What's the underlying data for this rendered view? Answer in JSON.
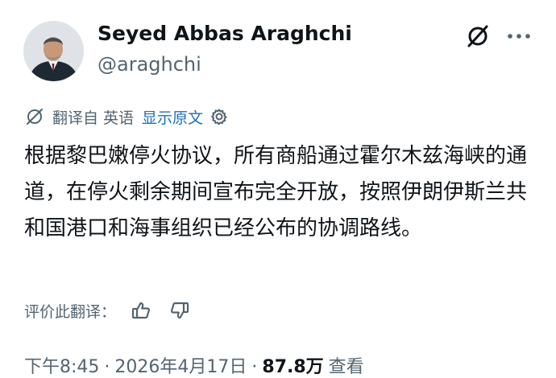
{
  "author": {
    "name": "Seyed Abbas Araghchi",
    "handle": "@araghchi"
  },
  "icons": {
    "grok": "slashed-circle-icon",
    "more": "more-dots-icon",
    "translate": "translate-icon",
    "settings": "gear-icon",
    "like": "thumbs-up-icon",
    "dislike": "thumbs-down-icon"
  },
  "translation": {
    "label": "翻译自 英语",
    "show_original": "显示原文"
  },
  "tweet": {
    "text": "根据黎巴嫩停火协议，所有商船通过霍尔木兹海峡的通道，在停火剩余期间宣布完全开放，按照伊朗伊斯兰共和国港口和海事组织已经公布的协调路线。"
  },
  "rating": {
    "label": "评价此翻译："
  },
  "meta": {
    "time": "下午8:45",
    "date": "2026年4月17日",
    "separator": "·",
    "views_count": "87.8万",
    "views_label": "查看"
  },
  "colors": {
    "text": "#0f1419",
    "secondary": "#536471",
    "link": "#1d6fb8"
  }
}
